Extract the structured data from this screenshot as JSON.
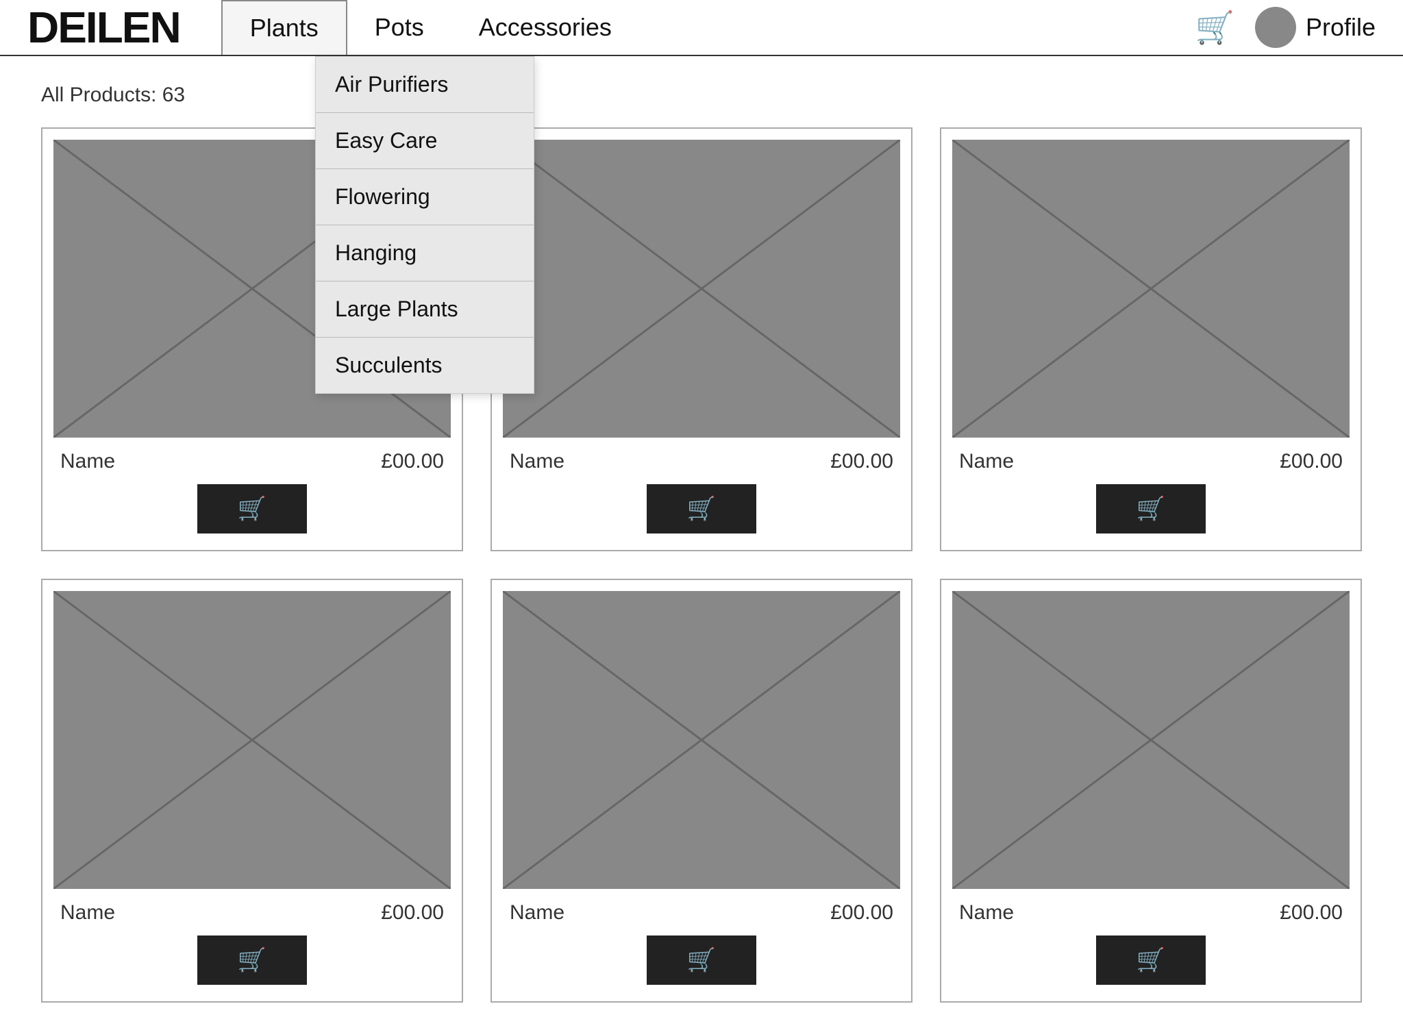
{
  "header": {
    "logo": "DEILEN",
    "nav": [
      {
        "id": "plants",
        "label": "Plants",
        "active": true
      },
      {
        "id": "pots",
        "label": "Pots",
        "active": false
      },
      {
        "id": "accessories",
        "label": "Accessories",
        "active": false
      }
    ],
    "cart_icon": "🛒",
    "profile_label": "Profile"
  },
  "dropdown": {
    "items": [
      {
        "id": "air-purifiers",
        "label": "Air Purifiers"
      },
      {
        "id": "easy-care",
        "label": "Easy Care"
      },
      {
        "id": "flowering",
        "label": "Flowering"
      },
      {
        "id": "hanging",
        "label": "Hanging"
      },
      {
        "id": "large-plants",
        "label": "Large Plants"
      },
      {
        "id": "succulents",
        "label": "Succulents"
      }
    ]
  },
  "main": {
    "products_count_label": "All Products: 63",
    "products": [
      {
        "id": "p1",
        "name": "Name",
        "price": "£00.00"
      },
      {
        "id": "p2",
        "name": "Name",
        "price": "£00.00"
      },
      {
        "id": "p3",
        "name": "Name",
        "price": "£00.00"
      },
      {
        "id": "p4",
        "name": "Name",
        "price": "£00.00"
      },
      {
        "id": "p5",
        "name": "Name",
        "price": "£00.00"
      },
      {
        "id": "p6",
        "name": "Name",
        "price": "£00.00"
      }
    ]
  }
}
